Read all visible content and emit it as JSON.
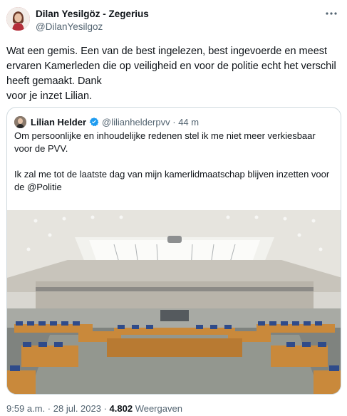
{
  "author": {
    "display_name": "Dilan Yesilgöz - Zegerius",
    "handle": "@DilanYesilgoz"
  },
  "tweet": {
    "text": "Wat een gemis. Een van de best ingelezen, best ingevoerde en meest ervaren Kamerleden die op veiligheid en voor de politie echt het verschil heeft gemaakt. Dank\nvoor je inzet Lilian."
  },
  "quoted": {
    "display_name": "Lilian Helder",
    "handle": "@lilianhelderpvv",
    "separator": "·",
    "time": "44 m",
    "text": "Om persoonlijke en inhoudelijke redenen stel ik me niet meer verkiesbaar voor de PVV.\n\nIk zal me tot de laatste dag van mijn kamerlidmaatschap blijven inzetten voor de @Politie",
    "heart_color": "#5d9ee6"
  },
  "footer": {
    "timestamp": "9:59 a.m. · 28 jul. 2023 · ",
    "views_count": "4.802",
    "views_label": " Weergaven"
  },
  "colors": {
    "text": "#0f1419",
    "secondary": "#536471",
    "border": "#cfd9de",
    "verified": "#1d9bf0"
  },
  "icons": [
    "more-icon",
    "verified-badge-icon",
    "blue-heart-icon"
  ]
}
